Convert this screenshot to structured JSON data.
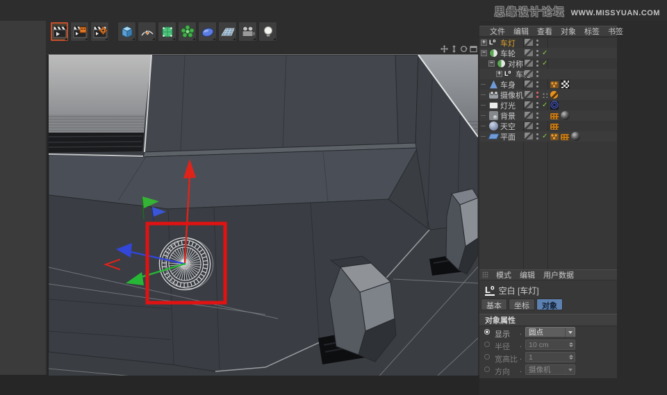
{
  "watermark": {
    "site_name": "思缘设计论坛",
    "site_url": "WWW.MISSYUAN.COM"
  },
  "toolbar": {
    "icons": [
      "render-view",
      "render-region",
      "render-settings",
      "primitive-cube",
      "spline-pen",
      "subdivision-surface",
      "array-modeling",
      "lens-deformer",
      "floor-environment",
      "camera",
      "light"
    ],
    "active_index": 0
  },
  "viewport": {
    "nav_icons": [
      "pan",
      "dolly",
      "rotate",
      "maximize"
    ],
    "axis_colors": {
      "x": "#3246d8",
      "y": "#e02319",
      "z": "#27b737"
    },
    "annotation_color": "#e01212",
    "selection_edge_color": "#e4e5e6",
    "wheel_color": "#e9e9e9"
  },
  "object_manager": {
    "menu": [
      "文件",
      "编辑",
      "查看",
      "对象",
      "标签",
      "书签"
    ],
    "items": [
      {
        "label": "车灯",
        "depth": 0,
        "expander": "plus",
        "icon": "i-nullobj",
        "selected": true,
        "dots": "gray",
        "check": "",
        "tags": []
      },
      {
        "label": "车轮",
        "depth": 0,
        "expander": "minus",
        "icon": "i-sphere",
        "selected": false,
        "dots": "gray",
        "check": "on",
        "tags": []
      },
      {
        "label": "对称",
        "depth": 1,
        "expander": "minus",
        "icon": "i-sphere",
        "selected": false,
        "dots": "gray",
        "check": "on",
        "tags": []
      },
      {
        "label": "车轮",
        "depth": 2,
        "expander": "plus",
        "icon": "i-nullobj",
        "selected": false,
        "dots": "gray",
        "check": "",
        "tags": []
      },
      {
        "label": "车身",
        "depth": 0,
        "expander": "leaf",
        "icon": "i-polyfig",
        "selected": false,
        "dots": "gray",
        "check": "",
        "tags": [
          "phong",
          "checker"
        ]
      },
      {
        "label": "摄像机",
        "depth": 0,
        "expander": "leaf",
        "icon": "i-camera",
        "selected": false,
        "dots": "red",
        "check": "dots4",
        "tags": [
          "protection"
        ]
      },
      {
        "label": "灯光",
        "depth": 0,
        "expander": "leaf",
        "icon": "i-arealight",
        "selected": false,
        "dots": "gray",
        "check": "on",
        "tags": [
          "target"
        ]
      },
      {
        "label": "背景",
        "depth": 0,
        "expander": "leaf",
        "icon": "i-background",
        "selected": false,
        "dots": "gray",
        "check": "",
        "tags": [
          "compositing",
          "material"
        ]
      },
      {
        "label": "天空",
        "depth": 0,
        "expander": "leaf",
        "icon": "i-sky",
        "selected": false,
        "dots": "gray",
        "check": "",
        "tags": [
          "compositing"
        ]
      },
      {
        "label": "平面",
        "depth": 0,
        "expander": "leaf",
        "icon": "i-plane",
        "selected": false,
        "dots": "gray",
        "check": "on",
        "tags": [
          "phong",
          "compositing",
          "material"
        ]
      }
    ]
  },
  "attribute_manager": {
    "menu": [
      "模式",
      "编辑",
      "用户数据"
    ],
    "object_icon": "null-object",
    "object_title": "空白 [车灯]",
    "tabs": [
      {
        "label": "基本",
        "active": false
      },
      {
        "label": "坐标",
        "active": false
      },
      {
        "label": "对象",
        "active": true
      }
    ],
    "section_title": "对象属性",
    "fields": [
      {
        "label": "显示",
        "value": "圆点",
        "control": "dropdown",
        "enabled": true,
        "radio_on": true
      },
      {
        "label": "半径",
        "value": "10 cm",
        "control": "spinner",
        "enabled": false,
        "radio_on": false
      },
      {
        "label": "宽高比",
        "value": "1",
        "control": "spinner",
        "enabled": false,
        "radio_on": false
      },
      {
        "label": "方向",
        "value": "摄像机",
        "control": "dropdown",
        "enabled": false,
        "radio_on": false
      }
    ]
  }
}
